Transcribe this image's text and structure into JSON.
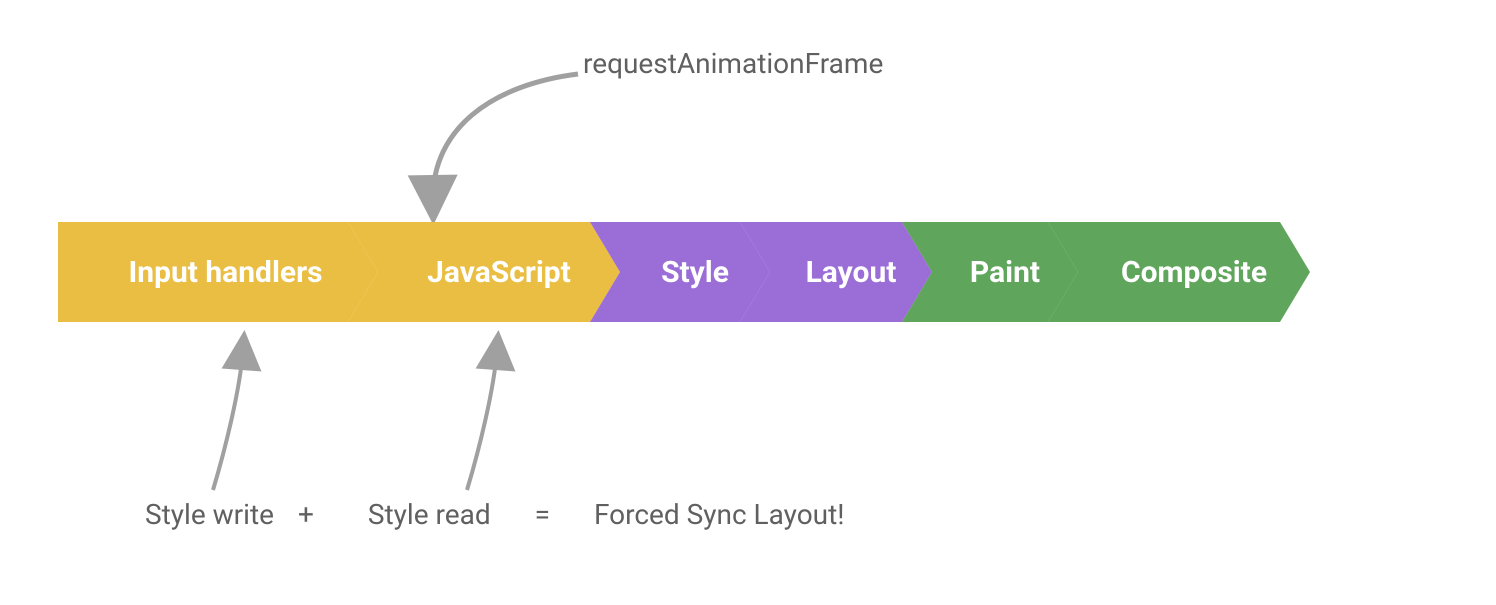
{
  "topLabel": "requestAnimationFrame",
  "steps": [
    {
      "label": "Input handlers",
      "color": "yellow",
      "width": "w1"
    },
    {
      "label": "JavaScript",
      "color": "yellow",
      "width": "w2"
    },
    {
      "label": "Style",
      "color": "purple",
      "width": "w3"
    },
    {
      "label": "Layout",
      "color": "purple",
      "width": "w4"
    },
    {
      "label": "Paint",
      "color": "green",
      "width": "w5"
    },
    {
      "label": "Composite",
      "color": "green",
      "width": "w6"
    }
  ],
  "bottom": {
    "styleWrite": "Style write",
    "plus": "+",
    "styleRead": "Style read",
    "equals": "=",
    "result": "Forced Sync Layout!"
  },
  "colors": {
    "yellow": "#eabe42",
    "purple": "#9a6dd7",
    "green": "#5fa55b",
    "text": "#606060",
    "arrow": "#a0a0a0"
  }
}
